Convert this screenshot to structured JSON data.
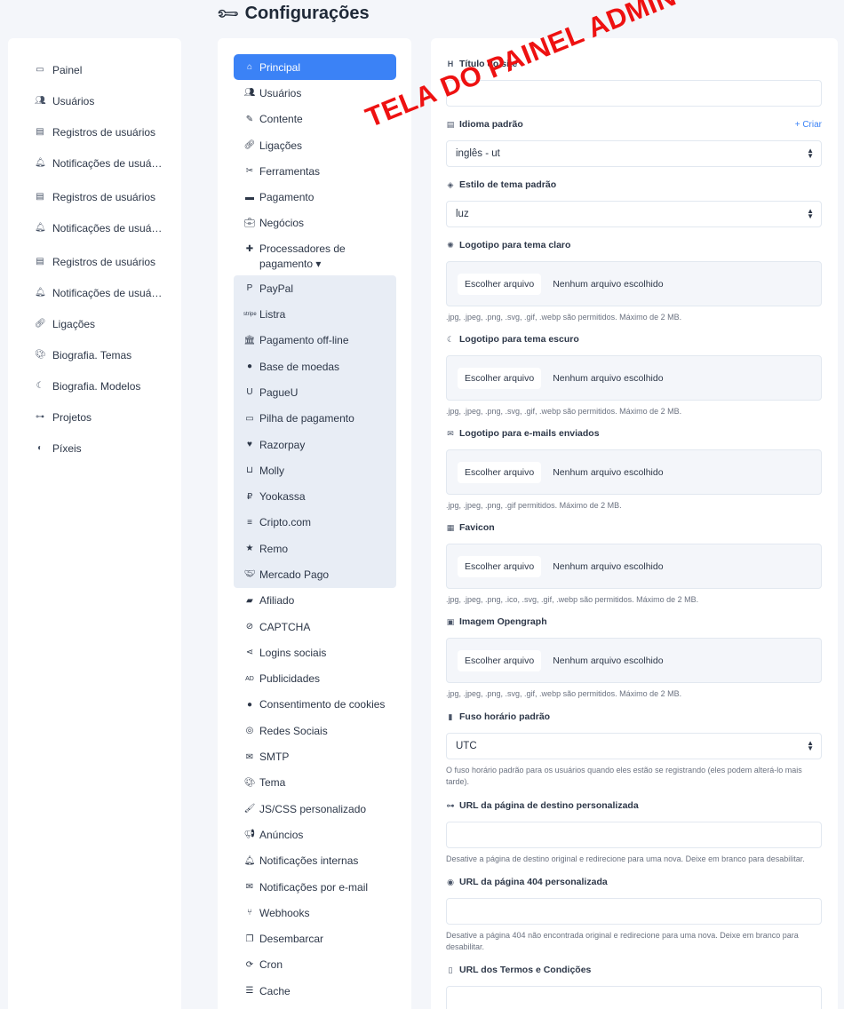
{
  "header": {
    "title": "Configurações"
  },
  "watermark": "TELA DO PAINEL ADMIN",
  "sidebar": {
    "items": [
      {
        "label": "Painel",
        "icon": "monitor-icon"
      },
      {
        "label": "Usuários",
        "icon": "users-icon"
      },
      {
        "label": "Registros de usuários",
        "icon": "scroll-icon"
      },
      {
        "label": "Notificações de usuá…",
        "icon": "bell-icon"
      },
      {
        "label": "Registros de usuários",
        "icon": "scroll-icon"
      },
      {
        "label": "Notificações de usuá…",
        "icon": "bell-icon"
      },
      {
        "label": "Registros de usuários",
        "icon": "scroll-icon"
      },
      {
        "label": "Notificações de usuá…",
        "icon": "bell-icon"
      },
      {
        "label": "Ligações",
        "icon": "link-icon"
      },
      {
        "label": "Biografia. Temas",
        "icon": "palette-icon"
      },
      {
        "label": "Biografia. Modelos",
        "icon": "moon-icon"
      },
      {
        "label": "Projetos",
        "icon": "project-diagram-icon"
      },
      {
        "label": "Píxeis",
        "icon": "adjust-icon"
      }
    ]
  },
  "menu": {
    "items": [
      {
        "label": "Principal",
        "icon": "home-icon",
        "active": true
      },
      {
        "label": "Usuários",
        "icon": "users-icon"
      },
      {
        "label": "Contente",
        "icon": "blog-icon"
      },
      {
        "label": "Ligações",
        "icon": "link-icon"
      },
      {
        "label": "Ferramentas",
        "icon": "tools-icon"
      },
      {
        "label": "Pagamento",
        "icon": "credit-card-icon"
      },
      {
        "label": "Negócios",
        "icon": "briefcase-icon"
      },
      {
        "label": "Processadores de pagamento ▾",
        "icon": "puzzle-icon"
      }
    ],
    "processors": [
      {
        "label": "PayPal",
        "icon": "paypal-icon"
      },
      {
        "label": "Listra",
        "icon": "stripe-icon"
      },
      {
        "label": "Pagamento off-line",
        "icon": "bank-icon"
      },
      {
        "label": "Base de moedas",
        "icon": "coinbase-icon"
      },
      {
        "label": "PagueU",
        "icon": "payu-icon"
      },
      {
        "label": "Pilha de pagamento",
        "icon": "money-card-icon"
      },
      {
        "label": "Razorpay",
        "icon": "heart-icon"
      },
      {
        "label": "Molly",
        "icon": "basket-icon"
      },
      {
        "label": "Yookassa",
        "icon": "ruble-icon"
      },
      {
        "label": "Cripto.com",
        "icon": "coins-icon"
      },
      {
        "label": "Remo",
        "icon": "star-icon"
      },
      {
        "label": "Mercado Pago",
        "icon": "handshake-icon"
      }
    ],
    "more": [
      {
        "label": "Afiliado",
        "icon": "wallet-icon"
      },
      {
        "label": "CAPTCHA",
        "icon": "low-vision-icon"
      },
      {
        "label": "Logins sociais",
        "icon": "share-icon"
      },
      {
        "label": "Publicidades",
        "icon": "ad-icon"
      },
      {
        "label": "Consentimento de cookies",
        "icon": "cookie-icon"
      },
      {
        "label": "Redes Sociais",
        "icon": "instagram-icon"
      },
      {
        "label": "SMTP",
        "icon": "mail-bulk-icon"
      },
      {
        "label": "Tema",
        "icon": "palette-icon"
      },
      {
        "label": "JS/CSS personalizado",
        "icon": "paint-brush-icon"
      },
      {
        "label": "Anúncios",
        "icon": "bullhorn-icon"
      },
      {
        "label": "Notificações internas",
        "icon": "bell-icon"
      },
      {
        "label": "Notificações por e-mail",
        "icon": "envelope-icon"
      },
      {
        "label": "Webhooks",
        "icon": "code-branch-icon"
      },
      {
        "label": "Desembarcar",
        "icon": "copy-icon"
      },
      {
        "label": "Cron",
        "icon": "sync-icon"
      },
      {
        "label": "Cache",
        "icon": "database-icon"
      }
    ]
  },
  "form": {
    "site_title": {
      "label": "Título do site",
      "value": ""
    },
    "language": {
      "label": "Idioma padrão",
      "create": "+ Criar",
      "value": "inglês - ut"
    },
    "theme": {
      "label": "Estilo de tema padrão",
      "value": "luz"
    },
    "logo_light": {
      "label": "Logotipo para tema claro",
      "button": "Escolher arquivo",
      "status": "Nenhum arquivo escolhido",
      "help": ".jpg, .jpeg, .png, .svg, .gif, .webp são permitidos. Máximo de 2 MB."
    },
    "logo_dark": {
      "label": "Logotipo para tema escuro",
      "button": "Escolher arquivo",
      "status": "Nenhum arquivo escolhido",
      "help": ".jpg, .jpeg, .png, .svg, .gif, .webp são permitidos. Máximo de 2 MB."
    },
    "logo_email": {
      "label": "Logotipo para e-mails enviados",
      "button": "Escolher arquivo",
      "status": "Nenhum arquivo escolhido",
      "help": ".jpg, .jpeg, .png, .gif permitidos. Máximo de 2 MB."
    },
    "favicon": {
      "label": "Favicon",
      "button": "Escolher arquivo",
      "status": "Nenhum arquivo escolhido",
      "help": ".jpg, .jpeg, .png, .ico, .svg, .gif, .webp são permitidos. Máximo de 2 MB."
    },
    "opengraph": {
      "label": "Imagem Opengraph",
      "button": "Escolher arquivo",
      "status": "Nenhum arquivo escolhido",
      "help": ".jpg, .jpeg, .png, .svg, .gif, .webp são permitidos. Máximo de 2 MB."
    },
    "timezone": {
      "label": "Fuso horário padrão",
      "value": "UTC",
      "help": "O fuso horário padrão para os usuários quando eles estão se registrando (eles podem alterá-lo mais tarde)."
    },
    "landing_url": {
      "label": "URL da página de destino personalizada",
      "value": "",
      "help": "Desative a página de destino original e redirecione para uma nova. Deixe em branco para desabilitar."
    },
    "not_found_url": {
      "label": "URL da página 404 personalizada",
      "value": "",
      "help": "Desative a página 404 não encontrada original e redirecione para uma nova. Deixe em branco para desabilitar."
    },
    "terms_url": {
      "label": "URL dos Termos e Condições",
      "value": ""
    }
  },
  "colors": {
    "accent": "#3b82f6",
    "watermark": "#ee1111",
    "submenu_bg": "#e8edf5"
  }
}
